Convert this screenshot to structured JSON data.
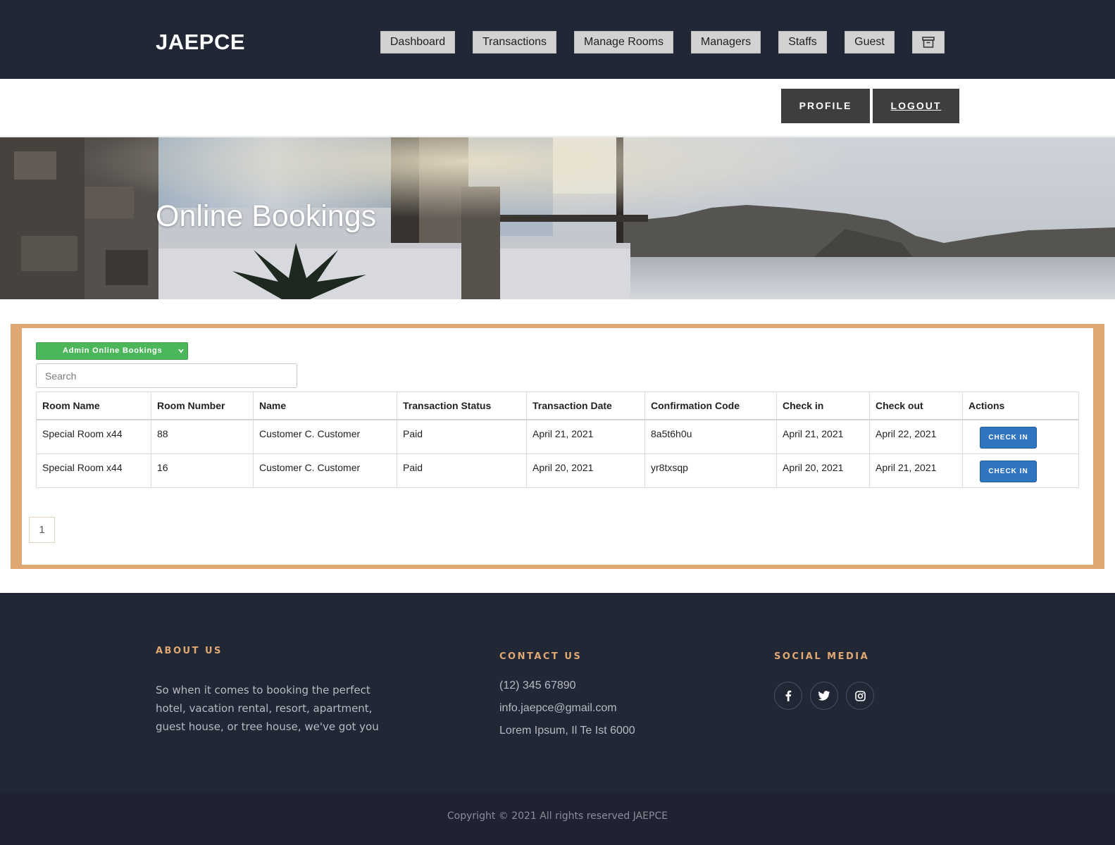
{
  "brand": "JAEPCE",
  "nav": {
    "items": [
      "Dashboard",
      "Transactions",
      "Manage Rooms",
      "Managers",
      "Staffs",
      "Guest"
    ],
    "archive_icon": "archive-icon"
  },
  "subnav": {
    "profile": "PROFILE",
    "logout": "LOGOUT"
  },
  "hero": {
    "title": "Online Bookings"
  },
  "panel": {
    "dropdown_label": "Admin Online Bookings",
    "search_placeholder": "Search",
    "table": {
      "columns": [
        "Room Name",
        "Room Number",
        "Name",
        "Transaction Status",
        "Transaction Date",
        "Confirmation Code",
        "Check in",
        "Check out",
        "Actions"
      ],
      "rows": [
        [
          "Special Room x44",
          "88",
          "Customer C. Customer",
          "Paid",
          "April 21, 2021",
          "8a5t6h0u",
          "April 21, 2021",
          "April 22, 2021",
          "CHECK IN"
        ],
        [
          "Special Room x44",
          "16",
          "Customer C. Customer",
          "Paid",
          "April 20, 2021",
          "yr8txsqp",
          "April 20, 2021",
          "April 21, 2021",
          "CHECK IN"
        ]
      ]
    },
    "pagination": {
      "current": "1"
    }
  },
  "footer": {
    "about": {
      "heading": "ABOUT US",
      "text": "So when it comes to booking the perfect hotel, vacation rental, resort, apartment, guest house, or tree house, we've got you"
    },
    "contact": {
      "heading": "CONTACT US",
      "phone": "(12) 345 67890",
      "email": "info.jaepce@gmail.com",
      "address": "Lorem Ipsum, Il Te Ist 6000"
    },
    "social": {
      "heading": "SOCIAL MEDIA",
      "icons": [
        "facebook-icon",
        "twitter-icon",
        "instagram-icon"
      ]
    },
    "copyright": "Copyright © 2021 All rights reserved JAEPCE"
  },
  "colors": {
    "navy": "#222736",
    "accent": "#dfa873",
    "green": "#4cb75a",
    "blue": "#2f75c0"
  }
}
